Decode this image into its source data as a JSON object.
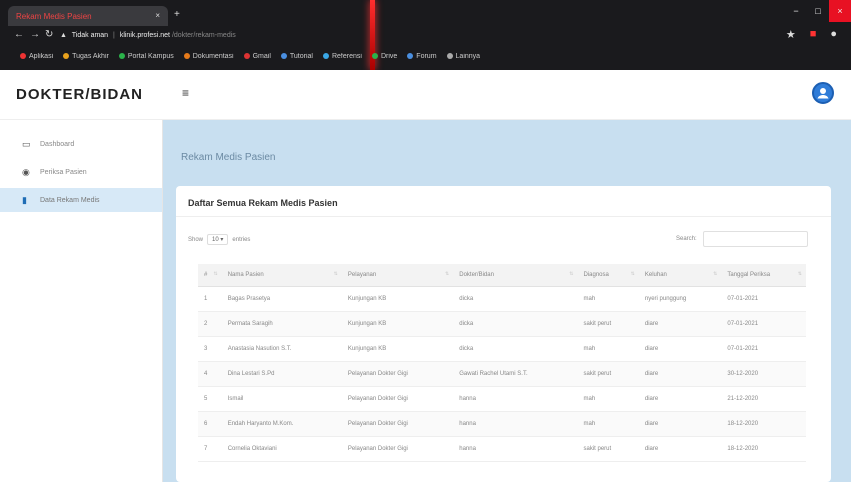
{
  "browser": {
    "tab_title": "Rekam Medis Pasien",
    "tab_close": "×",
    "new_tab": "+",
    "window_controls": {
      "minimize": "−",
      "maximize": "□",
      "close": "×"
    },
    "address": {
      "security_label": "Tidak aman",
      "domain": "klinik.profesi.net",
      "path": "/dokter/rekam-medis"
    },
    "bookmarks": [
      {
        "label": "Aplikasi",
        "color": "#e33"
      },
      {
        "label": "Tugas Akhir",
        "color": "#e9a21d"
      },
      {
        "label": "Portal Kampus",
        "color": "#2ab34a"
      },
      {
        "label": "Dokumentasi",
        "color": "#e67a1a"
      },
      {
        "label": "Gmail",
        "color": "#d33"
      },
      {
        "label": "Tutorial",
        "color": "#4a8fe0"
      },
      {
        "label": "Referensi",
        "color": "#3aa7e6"
      },
      {
        "label": "Drive",
        "color": "#2ab34a"
      },
      {
        "label": "Forum",
        "color": "#4a8fe0"
      },
      {
        "label": "Lainnya",
        "color": "#aaa"
      }
    ]
  },
  "app": {
    "brand": "DOKTER/BIDAN",
    "menu_icon": "≡",
    "user_icon": "user-circle-icon"
  },
  "sidebar": {
    "items": [
      {
        "label": "Dashboard",
        "icon": "monitor-icon",
        "active": false
      },
      {
        "label": "Periksa Pasien",
        "icon": "eye-icon",
        "active": false
      },
      {
        "label": "Data Rekam Medis",
        "icon": "document-icon",
        "active": true
      }
    ]
  },
  "main": {
    "page_title": "Rekam Medis Pasien",
    "card_title": "Daftar Semua Rekam Medis Pasien",
    "length": {
      "prefix": "Show",
      "value": "10",
      "suffix": "entries"
    },
    "search": {
      "label": "Search:",
      "value": ""
    },
    "table": {
      "headers": [
        "#",
        "Nama Pasien",
        "Pelayanan",
        "Dokter/Bidan",
        "Diagnosa",
        "Keluhan",
        "Tanggal Periksa"
      ],
      "rows": [
        [
          "1",
          "Bagas Prasetya",
          "Kunjungan KB",
          "dicka",
          "mah",
          "nyeri punggung",
          "07-01-2021"
        ],
        [
          "2",
          "Permata Saragih",
          "Kunjungan KB",
          "dicka",
          "sakit perut",
          "diare",
          "07-01-2021"
        ],
        [
          "3",
          "Anastasia Nasution S.T.",
          "Kunjungan KB",
          "dicka",
          "mah",
          "diare",
          "07-01-2021"
        ],
        [
          "4",
          "Dina Lestari S.Pd",
          "Pelayanan Dokter Gigi",
          "Gawati Rachel Utami S.T.",
          "sakit perut",
          "diare",
          "30-12-2020"
        ],
        [
          "5",
          "Ismail",
          "Pelayanan Dokter Gigi",
          "hanna",
          "mah",
          "diare",
          "21-12-2020"
        ],
        [
          "6",
          "Endah Haryanto M.Kom.",
          "Pelayanan Dokter Gigi",
          "hanna",
          "mah",
          "diare",
          "18-12-2020"
        ],
        [
          "7",
          "Cornelia Oktaviani",
          "Pelayanan Dokter Gigi",
          "hanna",
          "sakit perut",
          "diare",
          "18-12-2020"
        ]
      ]
    }
  }
}
